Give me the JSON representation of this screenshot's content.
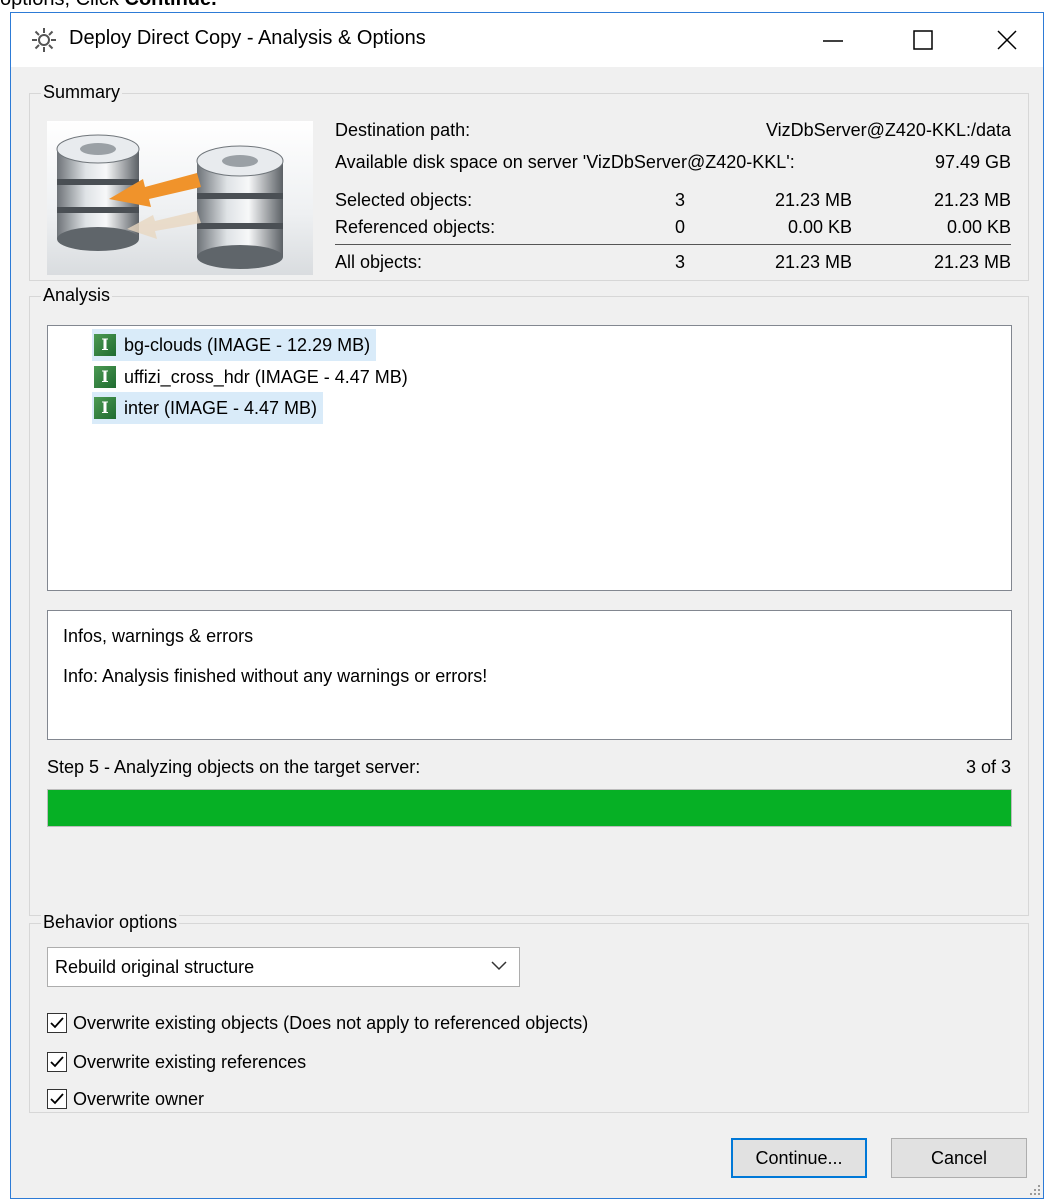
{
  "caption": {
    "prefix": "options, Click ",
    "bold": "Continue."
  },
  "window": {
    "title": "Deploy Direct Copy - Analysis & Options"
  },
  "summary": {
    "legend": "Summary",
    "destination_label": "Destination path:",
    "destination_value": "VizDbServer@Z420-KKL:/data",
    "disk_label": "Available disk space on server 'VizDbServer@Z420-KKL':",
    "disk_value": "97.49 GB",
    "rows": [
      {
        "label": "Selected objects:",
        "count": "3",
        "size1": "21.23 MB",
        "size2": "21.23 MB"
      },
      {
        "label": "Referenced objects:",
        "count": "0",
        "size1": "0.00 KB",
        "size2": "0.00 KB"
      },
      {
        "label": "All objects:",
        "count": "3",
        "size1": "21.23 MB",
        "size2": "21.23 MB"
      }
    ]
  },
  "analysis": {
    "legend": "Analysis",
    "items": [
      {
        "label": "bg-clouds (IMAGE - 12.29 MB)",
        "icon": "I"
      },
      {
        "label": "uffizi_cross_hdr (IMAGE - 4.47 MB)",
        "icon": "I"
      },
      {
        "label": "inter (IMAGE - 4.47 MB)",
        "icon": "I"
      }
    ],
    "info_title": "Infos, warnings & errors",
    "info_message": "Info: Analysis finished without any warnings or errors!",
    "step_label": "Step 5 - Analyzing objects on the target server:",
    "step_count": "3 of 3",
    "progress": 1.0,
    "progress_color": "#06b025"
  },
  "behavior": {
    "legend": "Behavior options",
    "select_value": "Rebuild original structure",
    "options": [
      {
        "label": "Overwrite existing objects (Does not apply to referenced objects)",
        "checked": true
      },
      {
        "label": "Overwrite existing references",
        "checked": true
      },
      {
        "label": "Overwrite owner",
        "checked": true
      }
    ]
  },
  "buttons": {
    "continue": "Continue...",
    "cancel": "Cancel"
  }
}
